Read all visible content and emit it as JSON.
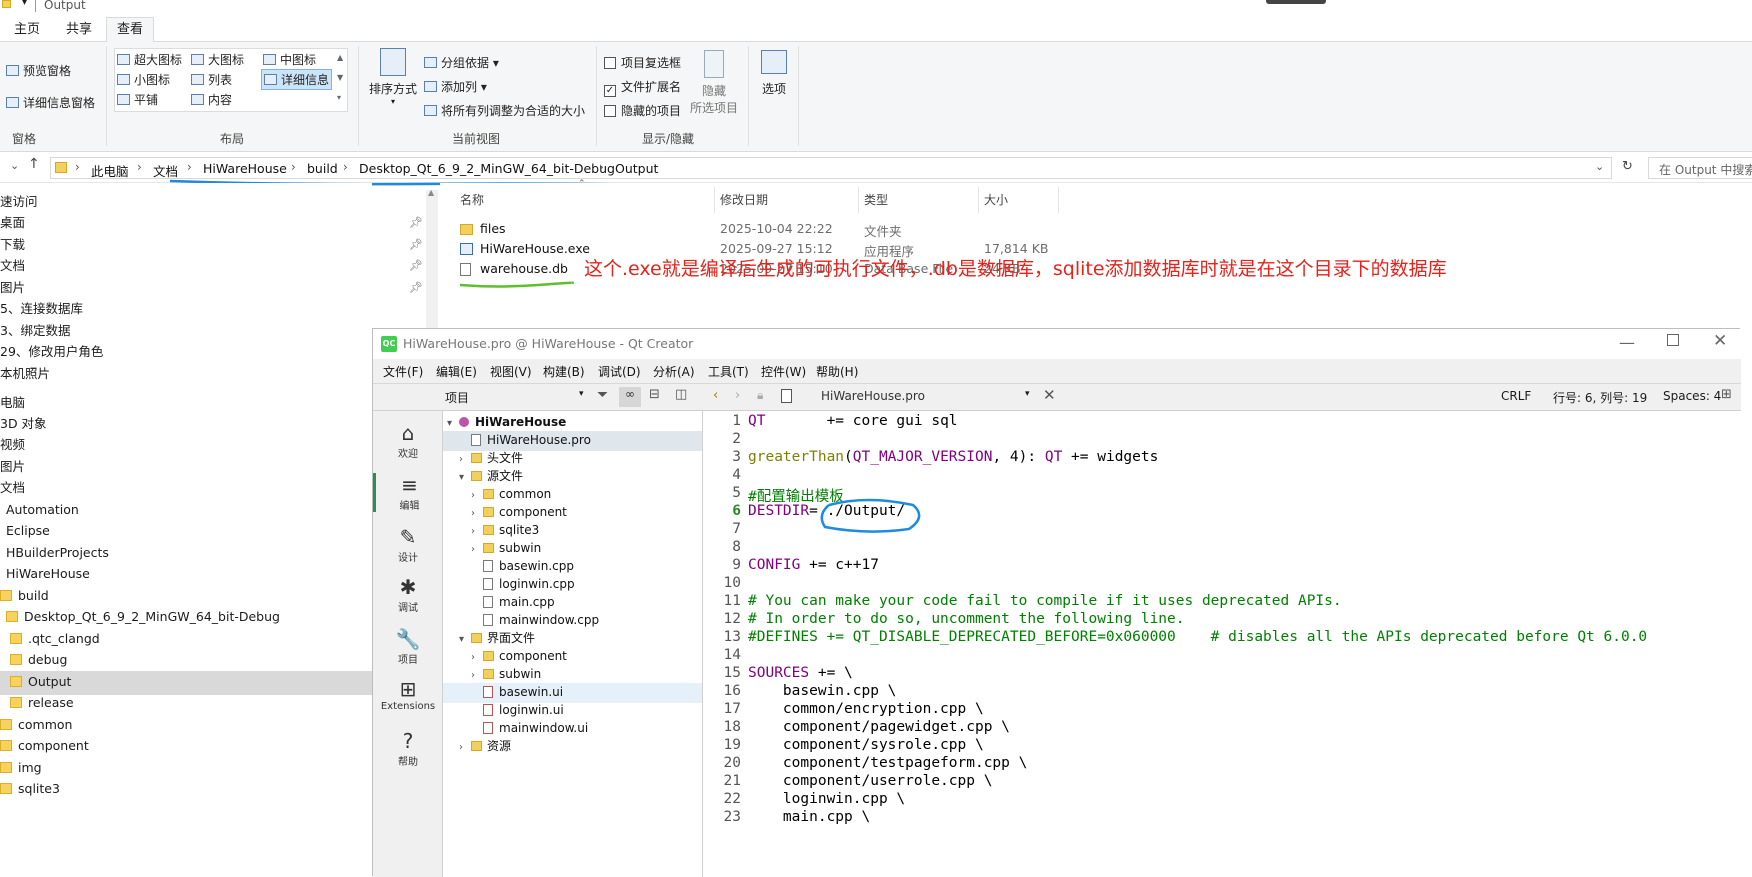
{
  "explorer": {
    "window_title": "Output",
    "tabs": [
      "主页",
      "共享",
      "查看"
    ],
    "active_tab": "查看",
    "ribbon": {
      "panes": {
        "preview_pane": "预览窗格",
        "details_pane": "详细信息窗格",
        "group": "窗格"
      },
      "layout": {
        "extra_large": "超大图标",
        "large": "大图标",
        "medium": "中图标",
        "small": "小图标",
        "list": "列表",
        "details": "详细信息",
        "tiles": "平铺",
        "content": "内容",
        "group": "布局"
      },
      "current_view": {
        "sort_by": "排序方式",
        "group_by": "分组依据",
        "add_columns": "添加列",
        "fit_columns": "将所有列调整为合适的大小",
        "group": "当前视图"
      },
      "show_hide": {
        "item_checkboxes": "项目复选框",
        "file_extensions": "文件扩展名",
        "hidden_items": "隐藏的项目",
        "hide": "隐藏",
        "selected_items": "所选项目",
        "group": "显示/隐藏"
      },
      "options": "选项"
    },
    "breadcrumb": [
      "此电脑",
      "文档",
      "HiWareHouse",
      "build",
      "Desktop_Qt_6_9_2_MinGW_64_bit-Debug",
      "Output"
    ],
    "search_placeholder": "在 Output 中搜索",
    "nav": [
      {
        "label": "速访问",
        "indent": 0,
        "pin": false
      },
      {
        "label": "桌面",
        "indent": 0,
        "pin": true
      },
      {
        "label": "下载",
        "indent": 0,
        "pin": true
      },
      {
        "label": "文档",
        "indent": 0,
        "pin": true
      },
      {
        "label": "图片",
        "indent": 0,
        "pin": true
      },
      {
        "label": "5、连接数据库",
        "indent": 0,
        "pin": false
      },
      {
        "label": "3、绑定数据",
        "indent": 0,
        "pin": false
      },
      {
        "label": "29、修改用户角色",
        "indent": 0,
        "pin": false
      },
      {
        "label": "本机照片",
        "indent": 0,
        "pin": false
      },
      {
        "label": "",
        "indent": 0,
        "pin": false
      },
      {
        "label": "电脑",
        "indent": 0,
        "pin": false
      },
      {
        "label": "3D 对象",
        "indent": 0,
        "pin": false
      },
      {
        "label": "视频",
        "indent": 0,
        "pin": false
      },
      {
        "label": "图片",
        "indent": 0,
        "pin": false
      },
      {
        "label": "文档",
        "indent": 0,
        "pin": false
      },
      {
        "label": "Automation",
        "indent": 1,
        "pin": false
      },
      {
        "label": "Eclipse",
        "indent": 1,
        "pin": false
      },
      {
        "label": "HBuilderProjects",
        "indent": 1,
        "pin": false
      },
      {
        "label": "HiWareHouse",
        "indent": 1,
        "pin": false
      },
      {
        "label": "build",
        "indent": 2,
        "pin": false
      },
      {
        "label": "Desktop_Qt_6_9_2_MinGW_64_bit-Debug",
        "indent": 3,
        "pin": false
      },
      {
        "label": ".qtc_clangd",
        "indent": 4,
        "pin": false
      },
      {
        "label": "debug",
        "indent": 4,
        "pin": false
      },
      {
        "label": "Output",
        "indent": 4,
        "pin": false,
        "selected": true
      },
      {
        "label": "release",
        "indent": 4,
        "pin": false
      },
      {
        "label": "common",
        "indent": 2,
        "pin": false
      },
      {
        "label": "component",
        "indent": 2,
        "pin": false
      },
      {
        "label": "img",
        "indent": 2,
        "pin": false
      },
      {
        "label": "sqlite3",
        "indent": 2,
        "pin": false
      }
    ],
    "columns": [
      "名称",
      "修改日期",
      "类型",
      "大小"
    ],
    "files": [
      {
        "name": "files",
        "date": "2025-10-04 22:22",
        "type": "文件夹",
        "size": "",
        "kind": "folder"
      },
      {
        "name": "HiWareHouse.exe",
        "date": "2025-09-27 15:12",
        "type": "应用程序",
        "size": "17,814 KB",
        "kind": "exe"
      },
      {
        "name": "warehouse.db",
        "date": "2025-09-27 15:10",
        "type": "Data Base File",
        "size": "24 KB",
        "kind": "db"
      }
    ],
    "annotation": "这个.exe就是编译后生成的可执行文件，.db是数据库，sqlite添加数据库时就是在这个目录下的数据库"
  },
  "qt": {
    "window_title": "HiWareHouse.pro @ HiWareHouse - Qt Creator",
    "logo": "QC",
    "menu": [
      "文件(F)",
      "编辑(E)",
      "视图(V)",
      "构建(B)",
      "调试(D)",
      "分析(A)",
      "工具(T)",
      "控件(W)",
      "帮助(H)"
    ],
    "project_combo": "项目",
    "open_file": "HiWareHouse.pro",
    "status": {
      "line_ending": "CRLF",
      "position": "行号: 6, 列号: 19",
      "indent": "Spaces: 4"
    },
    "modes": [
      {
        "label": "欢迎",
        "icon": "home-icon",
        "glyph": "⌂"
      },
      {
        "label": "编辑",
        "icon": "edit-icon",
        "glyph": "≡"
      },
      {
        "label": "设计",
        "icon": "design-icon",
        "glyph": "✎"
      },
      {
        "label": "调试",
        "icon": "debug-icon",
        "glyph": "✱"
      },
      {
        "label": "项目",
        "icon": "wrench-icon",
        "glyph": "🔧"
      },
      {
        "label": "Extensions",
        "icon": "extensions-icon",
        "glyph": "⊞"
      },
      {
        "label": "帮助",
        "icon": "help-icon",
        "glyph": "?"
      }
    ],
    "tree": [
      {
        "label": "HiWareHouse",
        "level": 0,
        "arrow": "▾",
        "kind": "project",
        "bold": true
      },
      {
        "label": "HiWareHouse.pro",
        "level": 1,
        "arrow": "",
        "kind": "file",
        "selected": true
      },
      {
        "label": "头文件",
        "level": 1,
        "arrow": "›",
        "kind": "folder-h"
      },
      {
        "label": "源文件",
        "level": 1,
        "arrow": "▾",
        "kind": "folder-c"
      },
      {
        "label": "common",
        "level": 2,
        "arrow": "›",
        "kind": "folder"
      },
      {
        "label": "component",
        "level": 2,
        "arrow": "›",
        "kind": "folder"
      },
      {
        "label": "sqlite3",
        "level": 2,
        "arrow": "›",
        "kind": "folder"
      },
      {
        "label": "subwin",
        "level": 2,
        "arrow": "›",
        "kind": "folder"
      },
      {
        "label": "basewin.cpp",
        "level": 2,
        "arrow": "",
        "kind": "file"
      },
      {
        "label": "loginwin.cpp",
        "level": 2,
        "arrow": "",
        "kind": "file"
      },
      {
        "label": "main.cpp",
        "level": 2,
        "arrow": "",
        "kind": "file"
      },
      {
        "label": "mainwindow.cpp",
        "level": 2,
        "arrow": "",
        "kind": "file"
      },
      {
        "label": "界面文件",
        "level": 1,
        "arrow": "▾",
        "kind": "folder-ui"
      },
      {
        "label": "component",
        "level": 2,
        "arrow": "›",
        "kind": "folder"
      },
      {
        "label": "subwin",
        "level": 2,
        "arrow": "›",
        "kind": "folder"
      },
      {
        "label": "basewin.ui",
        "level": 2,
        "arrow": "",
        "kind": "ui",
        "highlight": true
      },
      {
        "label": "loginwin.ui",
        "level": 2,
        "arrow": "",
        "kind": "ui"
      },
      {
        "label": "mainwindow.ui",
        "level": 2,
        "arrow": "",
        "kind": "ui"
      },
      {
        "label": "资源",
        "level": 1,
        "arrow": "›",
        "kind": "folder-res"
      }
    ],
    "code": [
      {
        "n": "1",
        "parts": [
          [
            "kw-purple",
            "QT"
          ],
          [
            "",
            "       += core gui sql"
          ]
        ]
      },
      {
        "n": "2",
        "parts": []
      },
      {
        "n": "3",
        "parts": [
          [
            "kw-olive",
            "greaterThan"
          ],
          [
            "",
            "("
          ],
          [
            "kw-purple",
            "QT_MAJOR_VERSION"
          ],
          [
            "",
            ", 4): "
          ],
          [
            "kw-purple",
            "QT"
          ],
          [
            "",
            " += widgets"
          ]
        ]
      },
      {
        "n": "4",
        "parts": []
      },
      {
        "n": "5",
        "parts": [
          [
            "kw-green",
            "#配置输出模板"
          ]
        ]
      },
      {
        "n": "6",
        "parts": [
          [
            "kw-purple",
            "DESTDIR"
          ],
          [
            "",
            "= ./Output/"
          ]
        ],
        "current": true
      },
      {
        "n": "7",
        "parts": []
      },
      {
        "n": "8",
        "parts": []
      },
      {
        "n": "9",
        "parts": [
          [
            "kw-purple",
            "CONFIG"
          ],
          [
            "",
            " += c++17"
          ]
        ]
      },
      {
        "n": "10",
        "parts": []
      },
      {
        "n": "11",
        "parts": [
          [
            "kw-green",
            "# You can make your code fail to compile if it uses deprecated APIs."
          ]
        ]
      },
      {
        "n": "12",
        "parts": [
          [
            "kw-green",
            "# In order to do so, uncomment the following line."
          ]
        ]
      },
      {
        "n": "13",
        "parts": [
          [
            "kw-green",
            "#DEFINES += QT_DISABLE_DEPRECATED_BEFORE=0x060000    # disables all the APIs deprecated before Qt 6.0.0"
          ]
        ]
      },
      {
        "n": "14",
        "parts": []
      },
      {
        "n": "15",
        "parts": [
          [
            "kw-purple",
            "SOURCES"
          ],
          [
            "",
            " += \\"
          ]
        ]
      },
      {
        "n": "16",
        "parts": [
          [
            "",
            "    basewin.cpp \\"
          ]
        ]
      },
      {
        "n": "17",
        "parts": [
          [
            "",
            "    common/encryption.cpp \\"
          ]
        ]
      },
      {
        "n": "18",
        "parts": [
          [
            "",
            "    component/pagewidget.cpp \\"
          ]
        ]
      },
      {
        "n": "19",
        "parts": [
          [
            "",
            "    component/sysrole.cpp \\"
          ]
        ]
      },
      {
        "n": "20",
        "parts": [
          [
            "",
            "    component/testpageform.cpp \\"
          ]
        ]
      },
      {
        "n": "21",
        "parts": [
          [
            "",
            "    component/userrole.cpp \\"
          ]
        ]
      },
      {
        "n": "22",
        "parts": [
          [
            "",
            "    loginwin.cpp \\"
          ]
        ]
      },
      {
        "n": "23",
        "parts": [
          [
            "",
            "    main.cpp \\"
          ]
        ]
      }
    ]
  },
  "colors": {
    "annotation_red": "#e5231b",
    "underline_blue": "#1f8be0",
    "underline_green": "#5cc02a"
  }
}
